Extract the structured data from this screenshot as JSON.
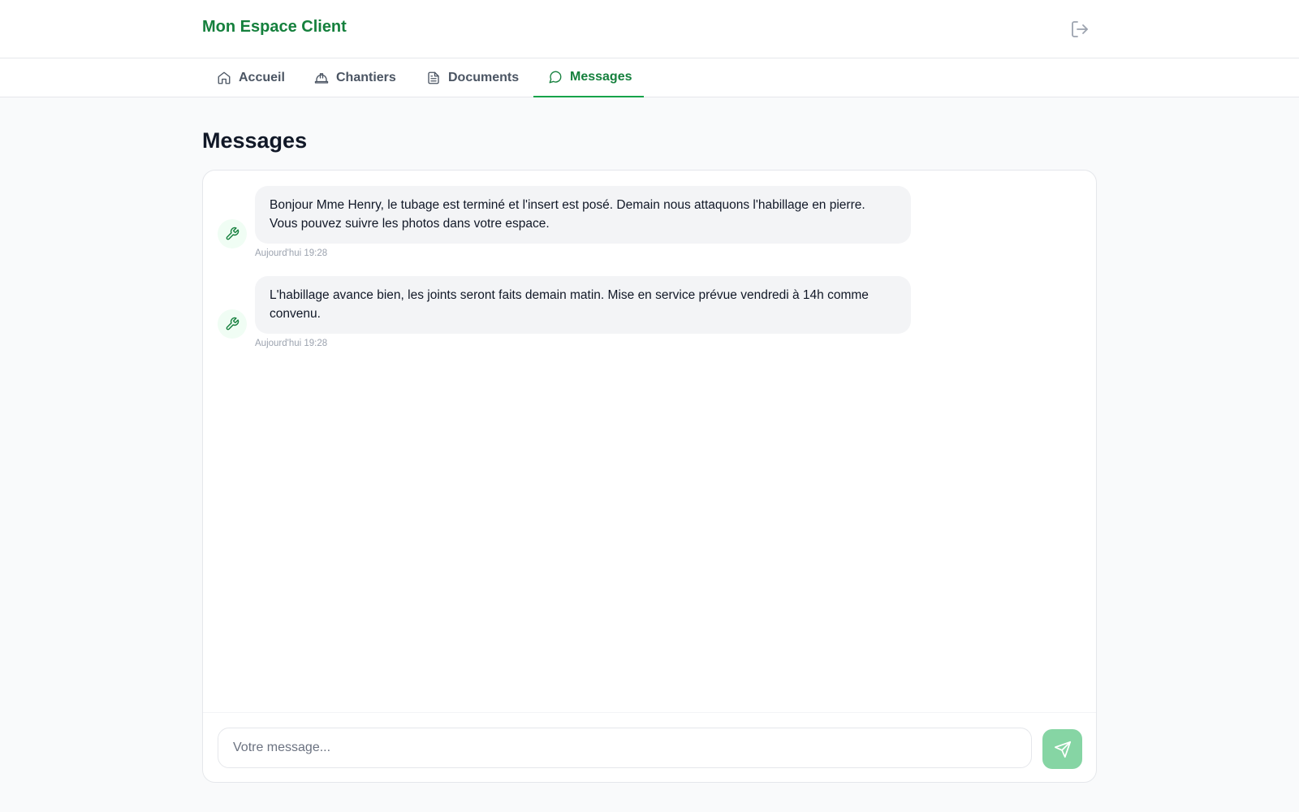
{
  "header": {
    "title": "Mon Espace Client",
    "logout_icon": "logout-icon"
  },
  "nav": {
    "tabs": [
      {
        "label": "Accueil",
        "icon": "home-icon",
        "active": false
      },
      {
        "label": "Chantiers",
        "icon": "hard-hat-icon",
        "active": false
      },
      {
        "label": "Documents",
        "icon": "document-icon",
        "active": false
      },
      {
        "label": "Messages",
        "icon": "chat-bubble-icon",
        "active": true
      }
    ]
  },
  "main": {
    "title": "Messages",
    "messages": [
      {
        "text": "Bonjour Mme Henry, le tubage est terminé et l'insert est posé. Demain nous attaquons l'habillage en pierre. Vous pouvez suivre les photos dans votre espace.",
        "time": "Aujourd'hui 19:28",
        "avatar_icon": "wrench-icon"
      },
      {
        "text": "L'habillage avance bien, les joints seront faits demain matin. Mise en service prévue vendredi à 14h comme convenu.",
        "time": "Aujourd'hui 19:28",
        "avatar_icon": "wrench-icon"
      }
    ],
    "composer": {
      "placeholder": "Votre message...",
      "value": "",
      "send_icon": "send-icon"
    }
  },
  "colors": {
    "brand": "#15803d",
    "accent": "#16a34a",
    "send_button": "#86d5a4",
    "bubble_bg": "#f3f4f6",
    "page_bg": "#f9fafb"
  }
}
